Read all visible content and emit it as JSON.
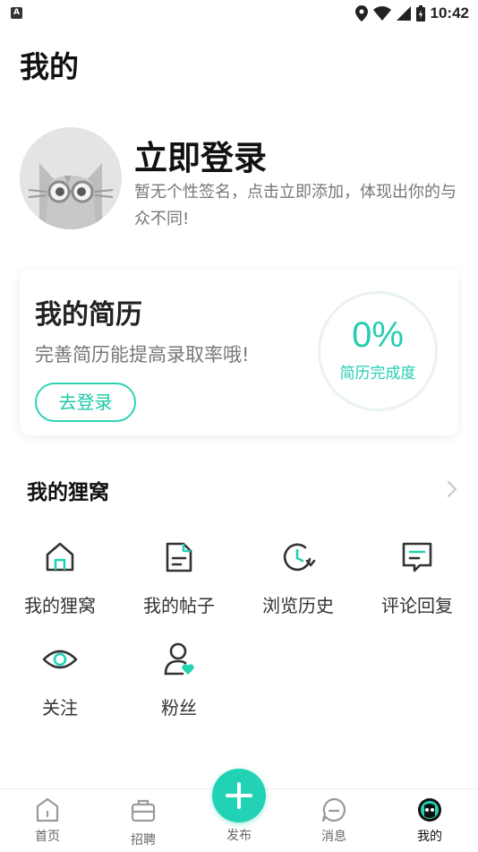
{
  "statusbar": {
    "left_badge": "A",
    "time": "10:42"
  },
  "page_title": "我的",
  "profile": {
    "login_title": "立即登录",
    "signature": "暂无个性签名，点击立即添加，体现出你的与众不同!"
  },
  "resume": {
    "title": "我的简历",
    "subtitle": "完善简历能提高录取率哦!",
    "login_button": "去登录",
    "completion_percent": "0%",
    "completion_label": "简历完成度"
  },
  "section": {
    "title": "我的狸窝"
  },
  "grid": {
    "items": [
      {
        "label": "我的狸窝",
        "icon": "home-icon"
      },
      {
        "label": "我的帖子",
        "icon": "post-icon"
      },
      {
        "label": "浏览历史",
        "icon": "history-icon"
      },
      {
        "label": "评论回复",
        "icon": "comment-icon"
      },
      {
        "label": "关注",
        "icon": "eye-icon"
      },
      {
        "label": "粉丝",
        "icon": "fans-icon"
      }
    ]
  },
  "tabbar": {
    "items": [
      {
        "label": "首页",
        "icon": "home-tab-icon"
      },
      {
        "label": "招聘",
        "icon": "briefcase-icon"
      },
      {
        "label": "发布",
        "icon": "plus-icon"
      },
      {
        "label": "消息",
        "icon": "message-icon"
      },
      {
        "label": "我的",
        "icon": "profile-face-icon"
      }
    ]
  },
  "colors": {
    "accent": "#22d2b4",
    "text": "#222222",
    "muted": "#777777"
  }
}
